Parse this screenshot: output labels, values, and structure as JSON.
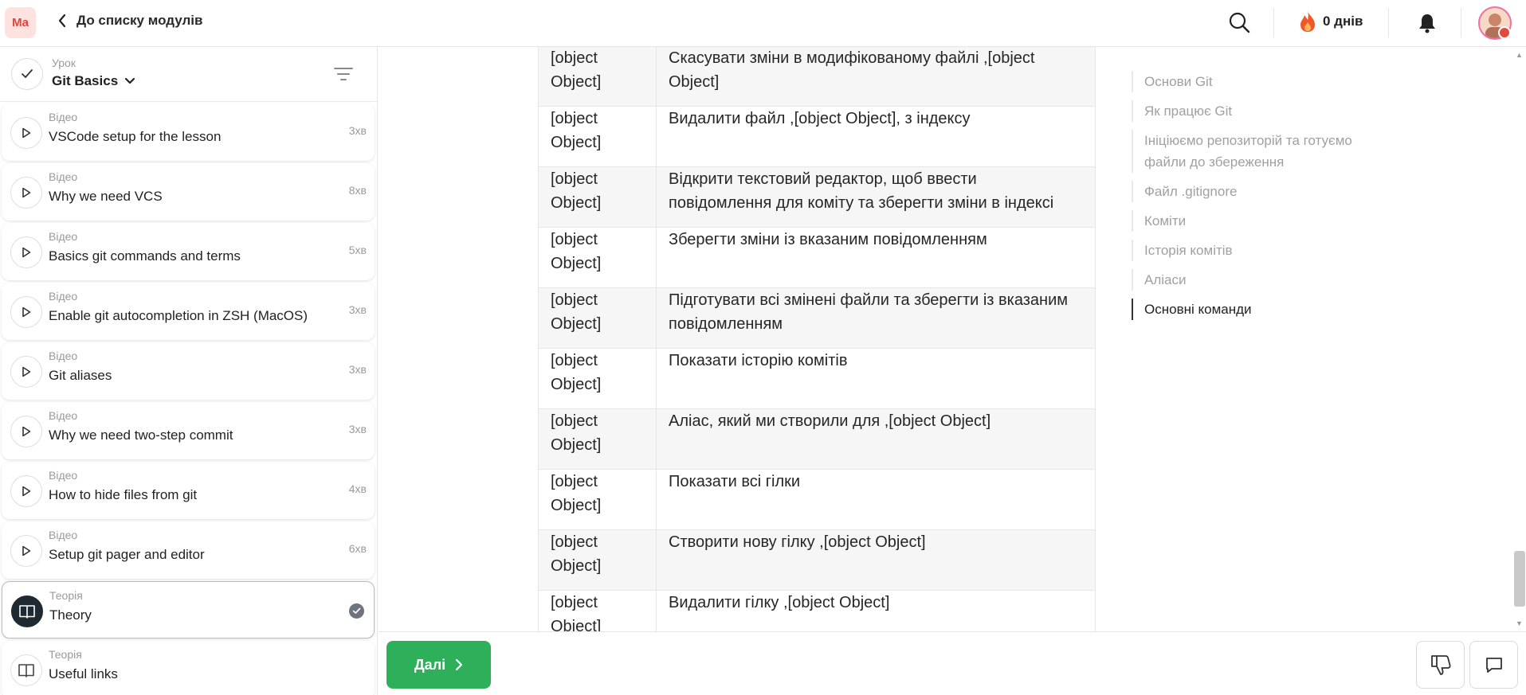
{
  "header": {
    "logo_text": "Ma",
    "back_label": "До списку модулів",
    "streak_label": "0 днів",
    "icons": [
      "search-icon",
      "flame-icon",
      "bell-icon",
      "avatar"
    ]
  },
  "lesson": {
    "caption": "Урок",
    "title": "Git Basics"
  },
  "sidebar": {
    "items": [
      {
        "type": "Відео",
        "title": "VSCode setup for the lesson",
        "duration": "3хв",
        "icon": "play-icon"
      },
      {
        "type": "Відео",
        "title": "Why we need VCS",
        "duration": "8хв",
        "icon": "play-icon"
      },
      {
        "type": "Відео",
        "title": "Basics git commands and terms",
        "duration": "5хв",
        "icon": "play-icon"
      },
      {
        "type": "Відео",
        "title": "Enable git autocompletion in ZSH (MacOS)",
        "duration": "3хв",
        "icon": "play-icon"
      },
      {
        "type": "Відео",
        "title": "Git aliases",
        "duration": "3хв",
        "icon": "play-icon"
      },
      {
        "type": "Відео",
        "title": "Why we need two-step commit",
        "duration": "3хв",
        "icon": "play-icon"
      },
      {
        "type": "Відео",
        "title": "How to hide files from git",
        "duration": "4хв",
        "icon": "play-icon"
      },
      {
        "type": "Відео",
        "title": "Setup git pager and editor",
        "duration": "6хв",
        "icon": "play-icon"
      },
      {
        "type": "Теорія",
        "title": "Theory",
        "duration": "",
        "icon": "book-icon",
        "active": true,
        "done": true
      },
      {
        "type": "Теорія",
        "title": "Useful links",
        "duration": "",
        "icon": "book-icon"
      }
    ]
  },
  "table": {
    "rows": [
      {
        "c1": "[object Object]",
        "c2": "Скасувати зміни в модифікованому файлі ,[object Object]"
      },
      {
        "c1": "[object Object]",
        "c2": "Видалити файл ,[object Object], з індексу"
      },
      {
        "c1": "[object Object]",
        "c2": "Відкрити текстовий редактор, щоб ввести повідомлення для коміту та зберегти зміни в індексі"
      },
      {
        "c1": "[object Object]",
        "c2": "Зберегти зміни із вказаним повідомленням"
      },
      {
        "c1": "[object Object]",
        "c2": "Підготувати всі змінені файли та зберегти із вказаним повідомленням"
      },
      {
        "c1": "[object Object]",
        "c2": "Показати історію комітів"
      },
      {
        "c1": "[object Object]",
        "c2": "Аліас, який ми створили для ,[object Object]"
      },
      {
        "c1": "[object Object]",
        "c2": "Показати всі гілки"
      },
      {
        "c1": "[object Object]",
        "c2": "Створити нову гілку ,[object Object]"
      },
      {
        "c1": "[object Object]",
        "c2": "Видалити гілку ,[object Object]"
      }
    ]
  },
  "toc": {
    "items": [
      {
        "label": "Основи Git"
      },
      {
        "label": "Як працює Git"
      },
      {
        "label": "Ініціюємо репозиторій та готуємо файли до збереження"
      },
      {
        "label": "Файл .gitignore"
      },
      {
        "label": "Коміти"
      },
      {
        "label": "Історія комітів"
      },
      {
        "label": "Аліаси"
      },
      {
        "label": "Основні команди",
        "active": true
      }
    ]
  },
  "footer": {
    "next_label": "Далі",
    "icons": [
      "thumbs-down-icon",
      "comment-icon"
    ]
  },
  "colors": {
    "accent_green": "#2eaf5a",
    "logo_red": "#e0443a",
    "flame": "#f0582a"
  }
}
